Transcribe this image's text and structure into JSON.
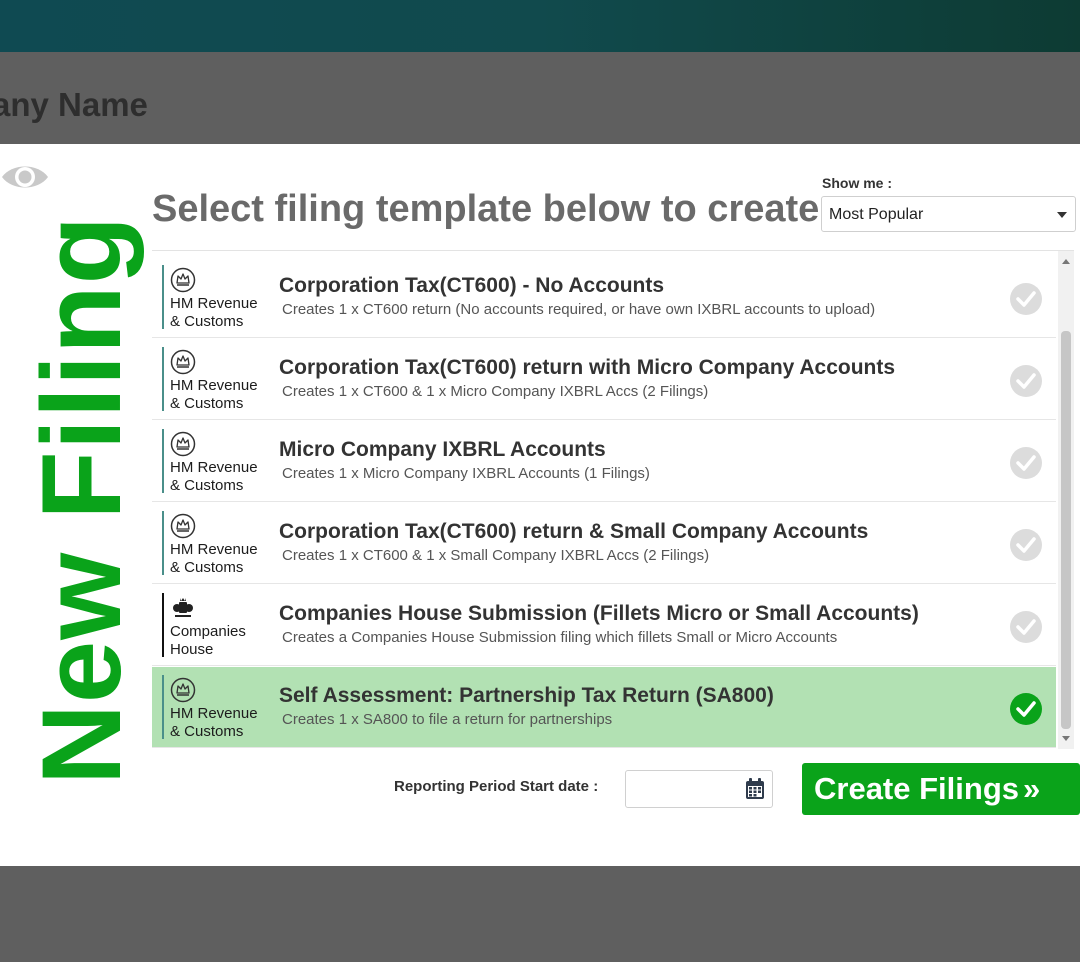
{
  "header": {
    "company_name": "any Name"
  },
  "overlay": {
    "new_filing_label": "New Filing"
  },
  "modal": {
    "heading": "Select filing template below to create",
    "show_me": {
      "label": "Show me :",
      "selected": "Most Popular"
    },
    "templates": [
      {
        "title": "Corporation Tax(CT600) - No Accounts",
        "description": "Creates 1 x CT600 return (No accounts required, or have own IXBRL accounts to upload)",
        "logo_line1": "HM Revenue",
        "logo_line2": "& Customs",
        "selected": false
      },
      {
        "title": "Corporation Tax(CT600) return with Micro Company Accounts",
        "description": "Creates 1 x CT600 & 1 x Micro Company IXBRL Accs (2 Filings)",
        "logo_line1": "HM Revenue",
        "logo_line2": "& Customs",
        "selected": false
      },
      {
        "title": "Micro Company IXBRL Accounts",
        "description": "Creates 1 x Micro Company IXBRL Accounts (1 Filings)",
        "logo_line1": "HM Revenue",
        "logo_line2": "& Customs",
        "selected": false
      },
      {
        "title": "Corporation Tax(CT600) return & Small Company Accounts",
        "description": "Creates 1 x CT600 & 1 x Small Company IXBRL Accs (2 Filings)",
        "logo_line1": "HM Revenue",
        "logo_line2": "& Customs",
        "selected": false
      },
      {
        "title": "Companies House Submission (Fillets Micro or Small Accounts)",
        "description": "Creates a Companies House Submission filing which fillets Small or Micro Accounts",
        "logo_line1": "Companies",
        "logo_line2": "House",
        "selected": false
      },
      {
        "title": "Self Assessment: Partnership Tax Return (SA800)",
        "description": "Creates 1 x SA800 to file a return for partnerships",
        "logo_line1": "HM Revenue",
        "logo_line2": "& Customs",
        "selected": true
      }
    ],
    "reporting_period": {
      "label": "Reporting Period Start date :",
      "value": ""
    },
    "create_button": {
      "label": "Create Filings",
      "chevron": "»"
    }
  },
  "colors": {
    "accent_green": "#0aa31a",
    "selected_row": "#b2e1b3",
    "check_inactive": "#dcdcdc",
    "check_active": "#0aa31a",
    "hmrc_teal": "#4a8f8a"
  }
}
